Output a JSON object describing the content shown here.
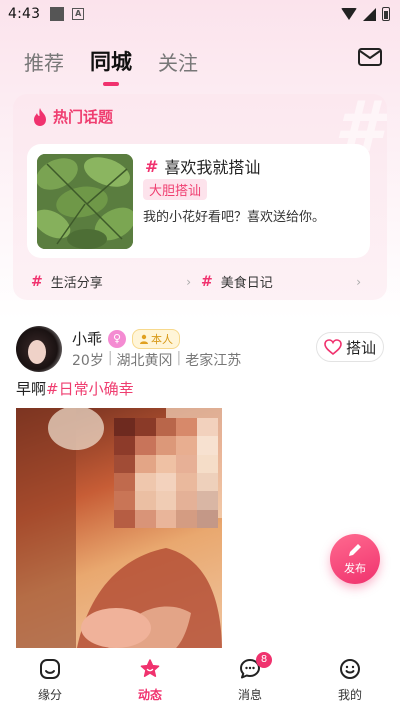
{
  "status_bar": {
    "time": "4:43",
    "a_label": "A"
  },
  "tabs": [
    {
      "label": "推荐"
    },
    {
      "label": "同城",
      "active": true
    },
    {
      "label": "关注"
    }
  ],
  "hot_topics": {
    "title": "热门话题",
    "hash_symbol": "#",
    "featured": {
      "name": "喜欢我就搭讪",
      "tag": "大胆搭讪",
      "description": "我的小花好看吧？喜欢送给你。"
    },
    "sub_topics": [
      {
        "label": "生活分享"
      },
      {
        "label": "美食日记"
      }
    ],
    "chevron": "›"
  },
  "post": {
    "username": "小乖",
    "gender_symbol": "♀",
    "self_badge": "本人",
    "age": "20岁",
    "location": "湖北黄冈",
    "hometown": "老家江苏",
    "meta_separator": "|",
    "chat_label": "搭讪",
    "text_prefix": "早啊",
    "text_tag": "#日常小确幸"
  },
  "publish_label": "发布",
  "bottom_nav": [
    {
      "label": "缘分",
      "icon": "fate-icon"
    },
    {
      "label": "动态",
      "icon": "feed-star-icon",
      "active": true
    },
    {
      "label": "消息",
      "icon": "message-icon",
      "badge": "8"
    },
    {
      "label": "我的",
      "icon": "profile-smile-icon"
    }
  ],
  "colors": {
    "accent": "#f0326e",
    "hot_title": "#ef3e70",
    "self_badge": "#d89a1a"
  }
}
